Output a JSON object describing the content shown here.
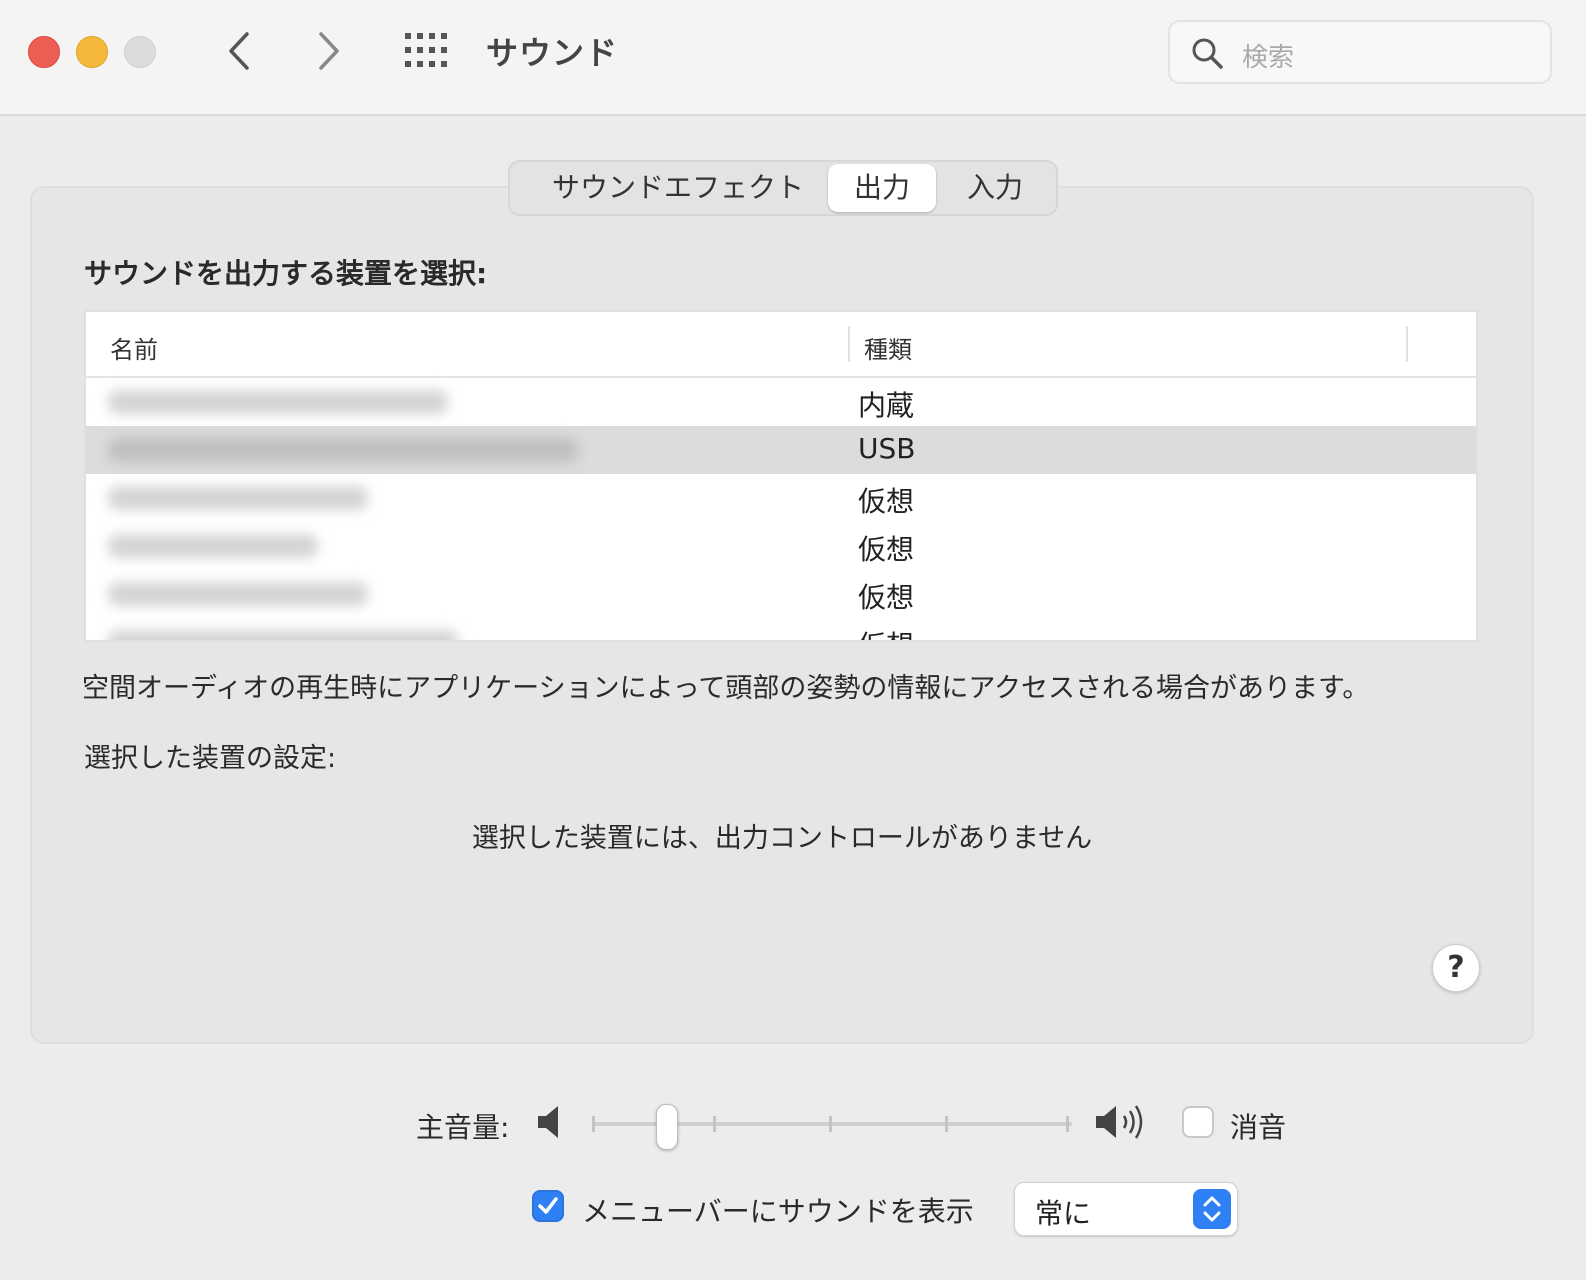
{
  "window": {
    "title": "サウンド"
  },
  "search": {
    "placeholder": "検索"
  },
  "tabs": [
    {
      "label": "サウンドエフェクト",
      "selected": false
    },
    {
      "label": "出力",
      "selected": true
    },
    {
      "label": "入力",
      "selected": false
    }
  ],
  "output": {
    "heading": "サウンドを出力する装置を選択:",
    "columns": {
      "name": "名前",
      "kind": "種類"
    },
    "devices": [
      {
        "kind": "内蔵"
      },
      {
        "kind": "USB",
        "selected": true
      },
      {
        "kind": "仮想"
      },
      {
        "kind": "仮想"
      },
      {
        "kind": "仮想"
      },
      {
        "kind": "仮想"
      }
    ],
    "info": "空間オーディオの再生時にアプリケーションによって頭部の姿勢の情報にアクセスされる場合があります。",
    "settings_heading": "選択した装置の設定:",
    "no_controls": "選択した装置には、出力コントロールがありません",
    "help": "?"
  },
  "volume": {
    "label": "主音量:",
    "level": 0.14,
    "mute_label": "消音",
    "muted": false
  },
  "menubar": {
    "label": "メニューバーにサウンドを表示",
    "checked": true,
    "select_value": "常に"
  },
  "colors": {
    "accent": "#2f7ff5",
    "close": "#ed5f55",
    "minimize": "#f5b83a"
  }
}
